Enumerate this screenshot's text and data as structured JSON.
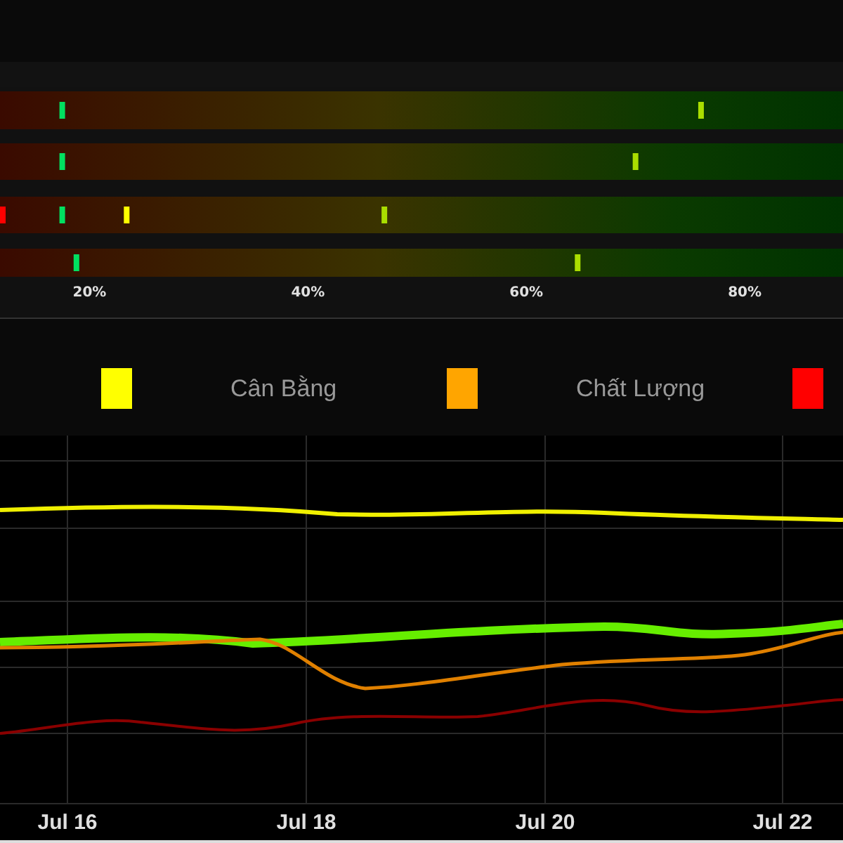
{
  "range_chart": {
    "x_labels": [
      "20%",
      "40%",
      "60%",
      "80%"
    ]
  },
  "legend": [
    {
      "label": "Cân Bằng",
      "color": "#ffff00"
    },
    {
      "label": "Chất Lượng",
      "color": "#ffa500"
    },
    {
      "color": "#ff0000"
    }
  ],
  "trend_chart": {
    "x_labels": [
      "Jul 16",
      "Jul 18",
      "Jul 20",
      "Jul 22"
    ]
  }
}
